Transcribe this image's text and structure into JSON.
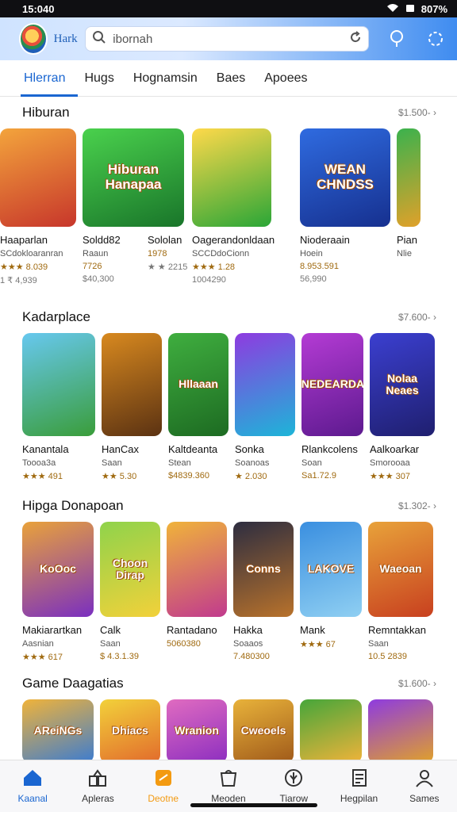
{
  "status": {
    "time": "15:040",
    "battery": "807%"
  },
  "header": {
    "app_name": "Hark",
    "search_value": "ibornah"
  },
  "tabs": [
    "Hlerran",
    "Hugs",
    "Hognamsin",
    "Baes",
    "Apoees"
  ],
  "sections": [
    {
      "title": "Hiburan",
      "more": "$1.500- ›",
      "cards": [
        {
          "name": "Haaparlan",
          "sub": "SCdokloaranran",
          "rating": "★★★ 8.039",
          "extra": "1 ₹ 4,939",
          "thumb": "",
          "colors": [
            "#f3a43c",
            "#c7362b"
          ]
        },
        {
          "name": "Soldd82",
          "sub": "Raaun",
          "rating": "7726",
          "extra": "$40,300",
          "thumb": "Hiburan Hanapaa",
          "colors": [
            "#4ad14d",
            "#19752a"
          ]
        },
        {
          "name": "Sololan",
          "sub": "",
          "rating": "1978",
          "extra": "★ ★ 2215",
          "thumb": "",
          "colors": [
            "#4ad14d",
            "#19752a"
          ]
        },
        {
          "name": "Oagerandonldaan",
          "sub": "SCCDdoCionn",
          "rating": "★★★ 1.28",
          "extra": "1004290",
          "thumb": "",
          "colors": [
            "#ffd94a",
            "#2aa637"
          ]
        },
        {
          "name": "Nioderaain",
          "sub": "Hoein",
          "rating": "8.953.591",
          "extra": "56,990",
          "thumb": "WEAN CHNDSS",
          "colors": [
            "#2f6be0",
            "#16308f"
          ]
        },
        {
          "name": "Pian",
          "sub": "Nlie",
          "rating": "",
          "extra": "",
          "thumb": "",
          "colors": [
            "#3bb24d",
            "#e0a12a"
          ]
        }
      ]
    },
    {
      "title": "Kadarplace",
      "more": "$7.600- ›",
      "cards": [
        {
          "name": "Kanantala",
          "sub": "Toooa3a",
          "rating": "★★★ 491",
          "extra": "",
          "thumb": "",
          "colors": [
            "#67c8ef",
            "#3a9d3a"
          ]
        },
        {
          "name": "HanCax",
          "sub": "Saan",
          "rating": "★★ 5.30",
          "extra": "",
          "thumb": "",
          "colors": [
            "#d8891f",
            "#5b3212"
          ]
        },
        {
          "name": "Kaltdeanta",
          "sub": "Stean",
          "rating": "$4839.360",
          "extra": "",
          "thumb": "Hllaaan",
          "colors": [
            "#3fae3f",
            "#1d6b22"
          ]
        },
        {
          "name": "Sonka",
          "sub": "Soanoas",
          "rating": "★ 2.030",
          "extra": "",
          "thumb": "",
          "colors": [
            "#8e3be0",
            "#1db5d8"
          ]
        },
        {
          "name": "Rlankcolens",
          "sub": "Soan",
          "rating": "Sa1.72.9",
          "extra": "",
          "thumb": "HANEDEARDAAS",
          "colors": [
            "#b43bd4",
            "#5d1a8f"
          ]
        },
        {
          "name": "Aalkoarkar",
          "sub": "Smorooaa",
          "rating": "★★★ 307",
          "extra": "",
          "thumb": "Nolaa Neaes",
          "colors": [
            "#3b3fd0",
            "#1f1f6f"
          ]
        }
      ]
    },
    {
      "title": "Hipga Donapoan",
      "more": "$1.302- ›",
      "cards": [
        {
          "name": "Makiarartkan",
          "sub": "Aasnian",
          "rating": "★★★ 617",
          "extra": "",
          "thumb": "KoOoc",
          "colors": [
            "#e9a23a",
            "#7a2fc0"
          ]
        },
        {
          "name": "Calk",
          "sub": "Saan",
          "rating": "$ 4.3.1.39",
          "extra": "",
          "thumb": "Choon Dirap",
          "colors": [
            "#8fd34b",
            "#f2d13a"
          ]
        },
        {
          "name": "Rantadano",
          "sub": "",
          "rating": "5060380",
          "extra": "",
          "thumb": "",
          "colors": [
            "#f0b33a",
            "#c13a8e"
          ]
        },
        {
          "name": "Hakka",
          "sub": "Soaaos",
          "rating": "7.480300",
          "extra": "",
          "thumb": "Conns",
          "colors": [
            "#2d2d40",
            "#b8722b"
          ]
        },
        {
          "name": "Mank",
          "sub": "",
          "rating": "★★★ 67",
          "extra": "",
          "thumb": "LAKOVE",
          "colors": [
            "#3a8fe0",
            "#8fcff2"
          ]
        },
        {
          "name": "Remntakkan",
          "sub": "Saan",
          "rating": "10.5 2839",
          "extra": "",
          "thumb": "Waeoan",
          "colors": [
            "#e8a23a",
            "#c8401f"
          ]
        }
      ]
    },
    {
      "title": "Game Daagatias",
      "more": "$1.600- ›",
      "cards": [
        {
          "name": "",
          "sub": "",
          "rating": "",
          "extra": "",
          "thumb": "AReiNGs",
          "colors": [
            "#f0b33a",
            "#3c7cd0"
          ]
        },
        {
          "name": "",
          "sub": "",
          "rating": "",
          "extra": "",
          "thumb": "Dhiacs",
          "colors": [
            "#f2d13a",
            "#e26b2c"
          ]
        },
        {
          "name": "",
          "sub": "",
          "rating": "",
          "extra": "",
          "thumb": "Wranion",
          "colors": [
            "#e06bc0",
            "#8d2fc0"
          ]
        },
        {
          "name": "",
          "sub": "",
          "rating": "",
          "extra": "",
          "thumb": "Cweoels",
          "colors": [
            "#e8b23a",
            "#a05a1a"
          ]
        },
        {
          "name": "",
          "sub": "",
          "rating": "",
          "extra": "",
          "thumb": "",
          "colors": [
            "#46a63a",
            "#f0b33a"
          ]
        },
        {
          "name": "",
          "sub": "",
          "rating": "",
          "extra": "",
          "thumb": "",
          "colors": [
            "#8e3be0",
            "#e0a12a"
          ]
        }
      ]
    }
  ],
  "bottom_nav": [
    {
      "label": "Kaanal",
      "icon": "home-icon",
      "state": "active"
    },
    {
      "label": "Apleras",
      "icon": "apps-icon",
      "state": ""
    },
    {
      "label": "Deotne",
      "icon": "promo-icon",
      "state": "promo"
    },
    {
      "label": "Meoden",
      "icon": "store-icon",
      "state": ""
    },
    {
      "label": "Tiarow",
      "icon": "compass-icon",
      "state": ""
    },
    {
      "label": "Hegpilan",
      "icon": "document-icon",
      "state": ""
    },
    {
      "label": "Sames",
      "icon": "person-icon",
      "state": ""
    }
  ]
}
